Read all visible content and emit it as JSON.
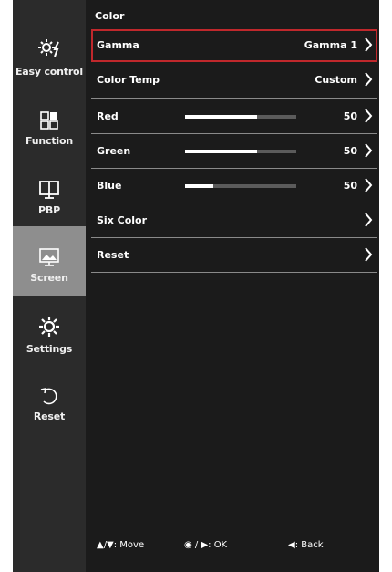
{
  "sidebar": {
    "items": [
      {
        "label": "Easy control",
        "icon": "easy-control-icon",
        "active": false
      },
      {
        "label": "Function",
        "icon": "function-icon",
        "active": false
      },
      {
        "label": "PBP",
        "icon": "pbp-icon",
        "active": false
      },
      {
        "label": "Screen",
        "icon": "screen-icon",
        "active": true
      },
      {
        "label": "Settings",
        "icon": "settings-icon",
        "active": false
      },
      {
        "label": "Reset",
        "icon": "reset-icon",
        "active": false
      }
    ]
  },
  "main": {
    "section_title": "Color",
    "rows": [
      {
        "label": "Gamma",
        "value": "Gamma 1",
        "selected": true
      },
      {
        "label": "Color Temp",
        "value": "Custom",
        "selected": false
      },
      {
        "label": "Red",
        "value": "50",
        "level": 0.65
      },
      {
        "label": "Green",
        "value": "50",
        "level": 0.65
      },
      {
        "label": "Blue",
        "value": "50",
        "level": 0.25
      },
      {
        "label": "Six Color",
        "value": ""
      },
      {
        "label": "Reset",
        "value": ""
      }
    ]
  },
  "footer": {
    "move": "▲/▼: Move",
    "ok": "◉ / ▶: OK",
    "back": "◀: Back"
  },
  "colors": {
    "sidebar_bg": "#2b2b2b",
    "main_bg": "#1b1b1b",
    "active_bg": "#8e8e8e",
    "selection_border": "#c0282c"
  }
}
